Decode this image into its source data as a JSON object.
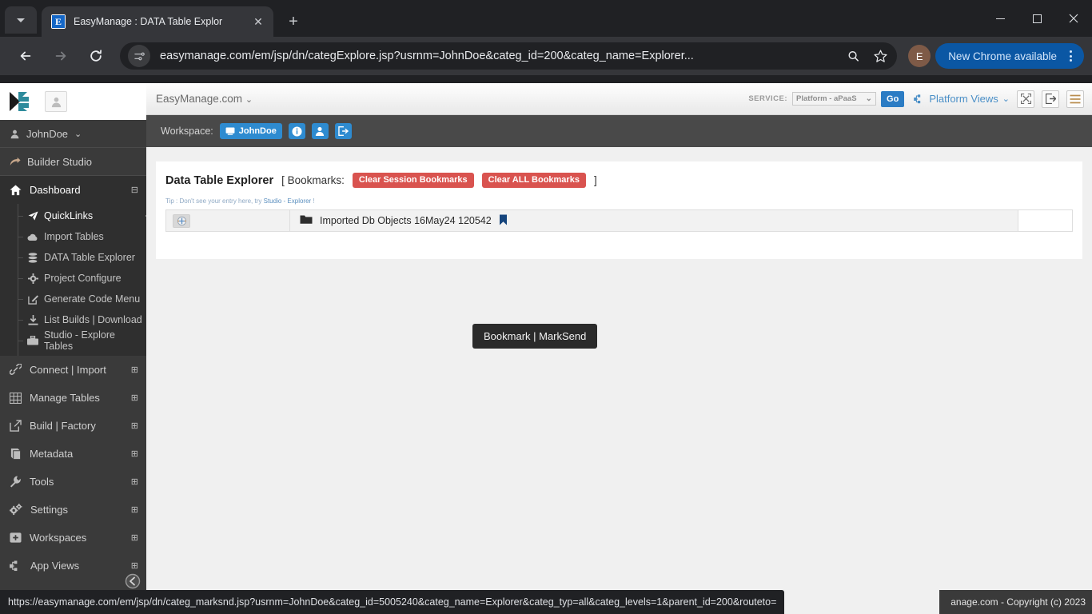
{
  "browser": {
    "tab": {
      "title": "EasyManage : DATA Table Explor",
      "favicon_letter": "E",
      "close_label": "✕"
    },
    "new_tab_label": "+",
    "window": {
      "minimize": "–",
      "maximize": "□",
      "close": "✕"
    },
    "omnibox": {
      "url": "easymanage.com/em/jsp/dn/categExplore.jsp?usrnm=JohnDoe&categ_id=200&categ_name=Explorer...",
      "site_info_icon": "tune-icon",
      "search_icon": "search-icon",
      "bookmark_icon": "star-icon"
    },
    "profile_initial": "E",
    "update_button": "New Chrome available",
    "menu_icon": "kebab-menu-icon"
  },
  "sidebar": {
    "logo_alt": "easymanage-logo",
    "avatar_icon": "user-avatar-icon",
    "user": {
      "label": "JohnDoe",
      "caret": "⌄"
    },
    "builder_studio": "Builder Studio",
    "dashboard": {
      "label": "Dashboard",
      "expander": "⊟"
    },
    "quick_items": [
      {
        "label": "QuickLinks",
        "icon": "paper-plane-icon",
        "selected": true
      },
      {
        "label": "Import Tables",
        "icon": "cloud-icon",
        "selected": false
      },
      {
        "label": "DATA Table Explorer",
        "icon": "database-icon",
        "selected": false
      },
      {
        "label": "Project Configure",
        "icon": "gear-icon",
        "selected": false
      },
      {
        "label": "Generate Code Menu",
        "icon": "edit-square-icon",
        "selected": false
      },
      {
        "label": "List Builds | Download",
        "icon": "download-icon",
        "selected": false
      },
      {
        "label": "Studio - Explore Tables",
        "icon": "briefcase-icon",
        "selected": false
      }
    ],
    "sections": [
      {
        "label": "Connect | Import",
        "icon": "link-icon",
        "expander": "⊞"
      },
      {
        "label": "Manage Tables",
        "icon": "table-icon",
        "expander": "⊞"
      },
      {
        "label": "Build | Factory",
        "icon": "external-link-icon",
        "expander": "⊞"
      },
      {
        "label": "Metadata",
        "icon": "book-icon",
        "expander": "⊞"
      },
      {
        "label": "Tools",
        "icon": "wrench-icon",
        "expander": "⊞"
      },
      {
        "label": "Settings",
        "icon": "gears-icon",
        "expander": "⊞"
      },
      {
        "label": "Workspaces",
        "icon": "plus-square-icon",
        "expander": "⊞"
      },
      {
        "label": "App Views",
        "icon": "sitemap-icon",
        "expander": "⊞"
      }
    ],
    "collapse_icon": "collapse-left-icon"
  },
  "app_header": {
    "brand": "EasyManage.com",
    "brand_caret": "⌄",
    "service_label": "SERVICE:",
    "service_value": "Platform - aPaaS",
    "service_caret": "⌄",
    "go_button": "Go",
    "platform_views": "Platform Views",
    "platform_views_caret": "⌄",
    "icon_buttons": [
      {
        "name": "expand-fullscreen-icon"
      },
      {
        "name": "logout-icon"
      },
      {
        "name": "hamburger-menu-icon"
      }
    ]
  },
  "workspace_bar": {
    "label": "Workspace:",
    "active_workspace": "JohnDoe",
    "buttons": [
      {
        "name": "info-icon"
      },
      {
        "name": "user-icon"
      },
      {
        "name": "signout-icon"
      }
    ]
  },
  "main": {
    "title": "Data Table Explorer",
    "bookmarks_prefix": "[ Bookmarks:",
    "clear_session_button": "Clear Session Bookmarks",
    "clear_all_button": "Clear ALL Bookmarks",
    "bookmarks_suffix": "]",
    "tip_prefix": "Tip : Don't see your entry here, try ",
    "tip_link": "Studio - Explorer",
    "tip_suffix": " !",
    "rows": [
      {
        "action_icon": "expand-node-icon",
        "folder_icon": "folder-icon",
        "name": "Imported Db Objects 16May24 120542",
        "bookmark_icon": "bookmark-flag-icon"
      }
    ]
  },
  "tooltip": {
    "text": "Bookmark | MarkSend"
  },
  "statusbar": {
    "url": "https://easymanage.com/em/jsp/dn/categ_marksnd.jsp?usrnm=JohnDoe&categ_id=5005240&categ_name=Explorer&categ_typ=all&categ_levels=1&parent_id=200&routeto="
  },
  "footer": {
    "copyright": "anage.com - Copyright (c) 2023"
  },
  "colors": {
    "accent_blue": "#2e8bd0",
    "danger_red": "#d9534f",
    "sidebar_bg": "#3a3a3a",
    "chrome_bg": "#202124",
    "update_pill": "#0b57a4"
  }
}
